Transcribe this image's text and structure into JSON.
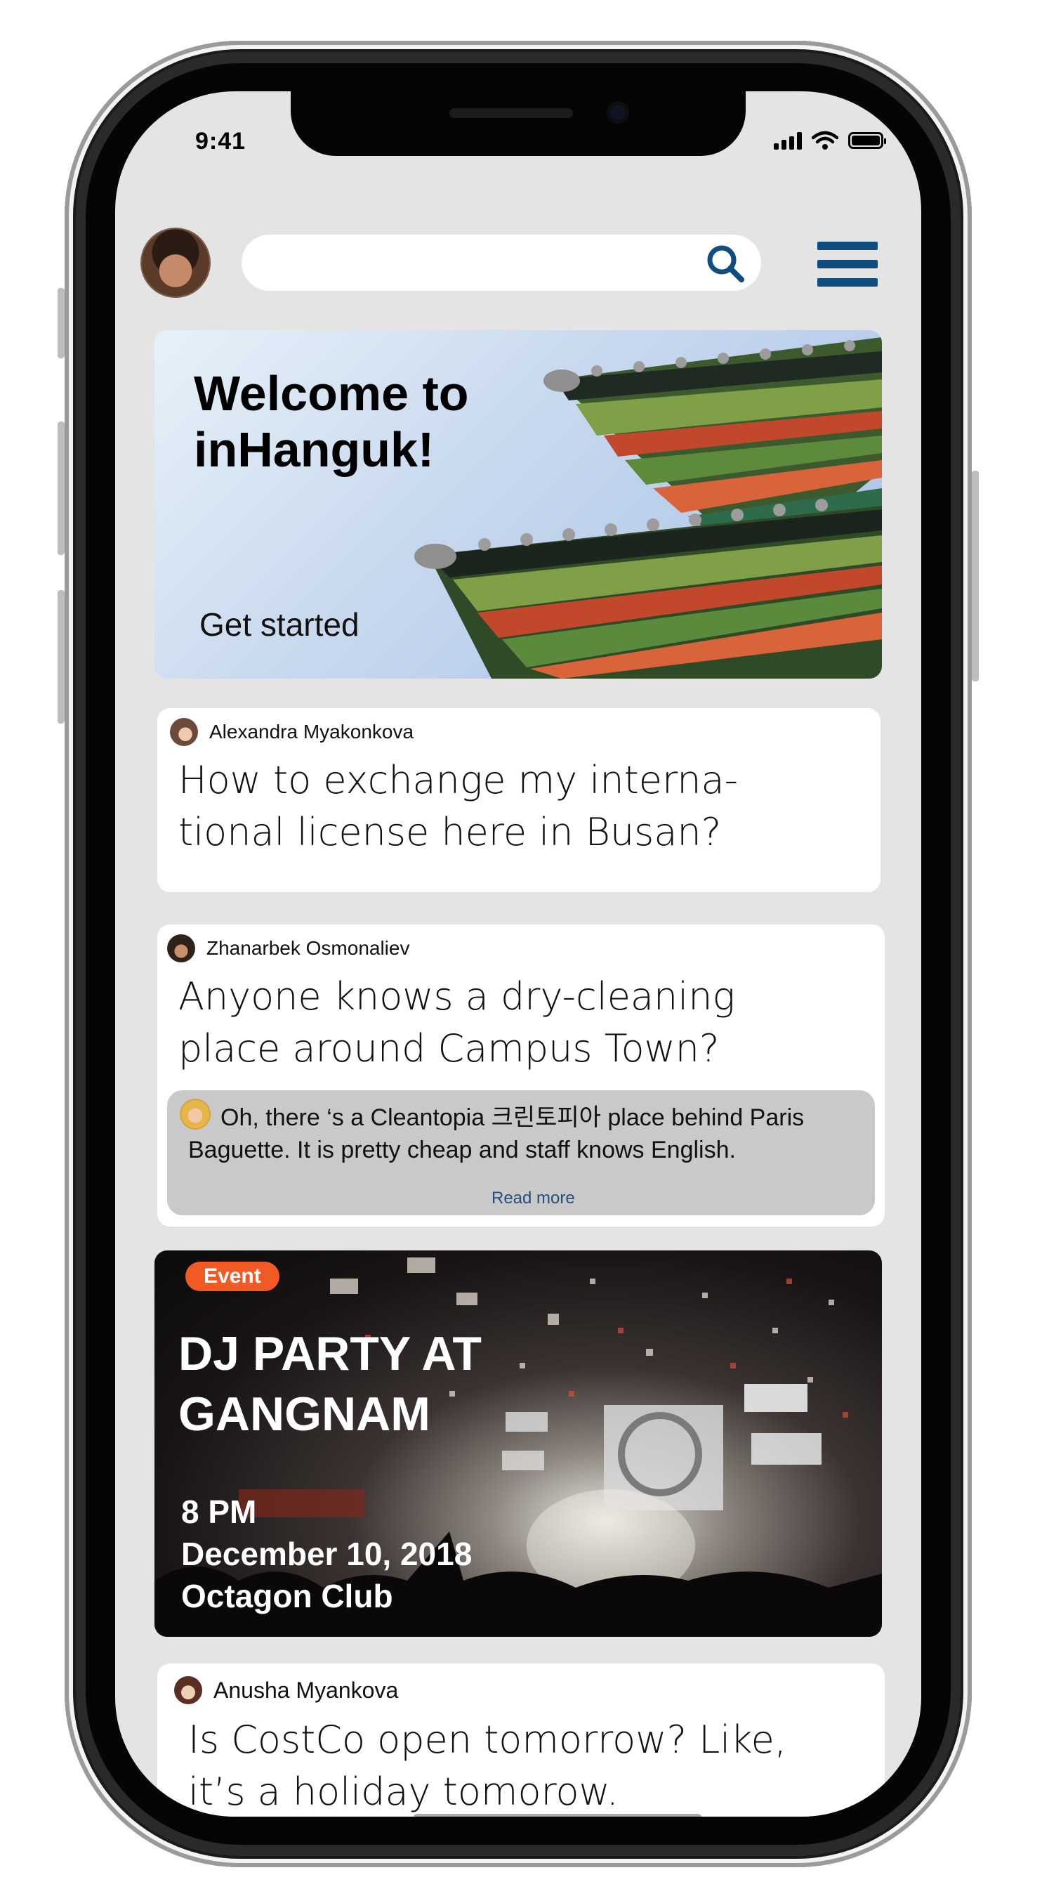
{
  "status_bar": {
    "time": "9:41"
  },
  "search": {
    "placeholder": ""
  },
  "welcome": {
    "title": "Welcome to\ninHanguk!",
    "cta": "Get started"
  },
  "posts": [
    {
      "author": "Alexandra Myakonkova",
      "question": "How to exchange my interna-\ntional license here in Busan?"
    },
    {
      "author": "Zhanarbek Osmonaliev",
      "question": "Anyone knows a dry-cleaning\nplace around Campus Town?",
      "reply": {
        "text": "Oh, there ‘s a Cleantopia 크린토피아 place behind Paris Baguette. It is pretty cheap and staff knows English.",
        "read_more": "Read more"
      }
    },
    {
      "author": "Anusha Myankova",
      "question": "Is CostCo open tomorrow? Like,\nit’s a holiday tomorow."
    }
  ],
  "event": {
    "badge": "Event",
    "title_line1": "DJ PARTY AT",
    "title_line2": "GANGNAM",
    "time": "8 PM",
    "date": "December 10, 2018",
    "venue": "Octagon Club"
  },
  "colors": {
    "accent": "#0e4d7e",
    "event_badge": "#f15a24",
    "screen_bg": "#e4e4e4"
  }
}
